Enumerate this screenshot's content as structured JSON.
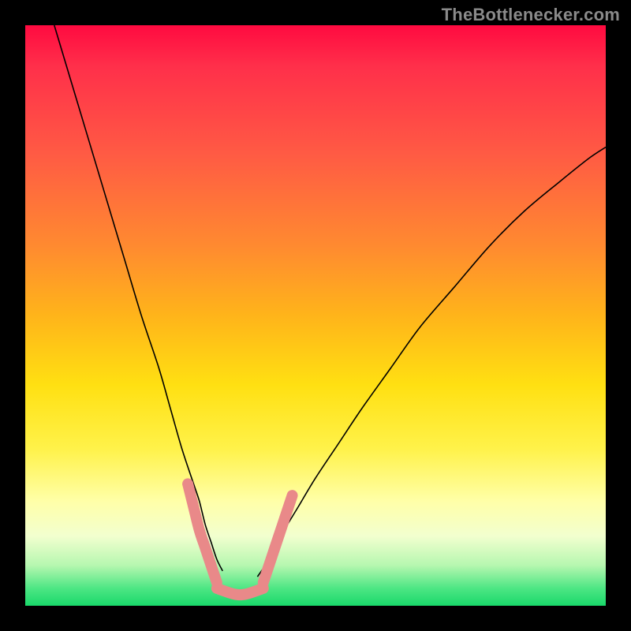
{
  "watermark": {
    "text": "TheBottlenecker.com"
  },
  "chart_data": {
    "type": "line",
    "title": "",
    "xlabel": "",
    "ylabel": "",
    "xlim": [
      0,
      100
    ],
    "ylim": [
      0,
      100
    ],
    "grid": false,
    "legend": false,
    "minimum_region_x": [
      33,
      41
    ],
    "series": [
      {
        "name": "left-descent",
        "stroke": "#000000",
        "width": 1.6,
        "x": [
          5,
          8,
          11,
          14,
          17,
          20,
          23,
          25,
          27,
          29,
          30,
          31,
          32,
          33,
          34
        ],
        "y": [
          100,
          90,
          80,
          70,
          60,
          50,
          41,
          34,
          27,
          21,
          18,
          14,
          11,
          8,
          6
        ]
      },
      {
        "name": "right-ascent",
        "stroke": "#000000",
        "width": 1.6,
        "x": [
          40,
          42,
          44,
          47,
          50,
          54,
          58,
          63,
          68,
          74,
          80,
          86,
          92,
          97,
          100
        ],
        "y": [
          5,
          8,
          12,
          17,
          22,
          28,
          34,
          41,
          48,
          55,
          62,
          68,
          73,
          77,
          79
        ]
      },
      {
        "name": "bottom-flat",
        "stroke": "#e98989",
        "width": 14,
        "linecap": "round",
        "x": [
          33,
          36,
          38,
          41
        ],
        "y": [
          3,
          2,
          2,
          3
        ]
      },
      {
        "name": "left-highlight",
        "stroke": "#e98989",
        "width": 14,
        "linecap": "round",
        "x": [
          28,
          29,
          30,
          31,
          32,
          33
        ],
        "y": [
          21,
          17,
          13,
          10,
          7,
          4
        ]
      },
      {
        "name": "right-highlight",
        "stroke": "#e98989",
        "width": 14,
        "linecap": "round",
        "x": [
          41,
          42,
          43,
          44,
          45,
          46
        ],
        "y": [
          4,
          7,
          10,
          13,
          16,
          19
        ]
      }
    ]
  }
}
